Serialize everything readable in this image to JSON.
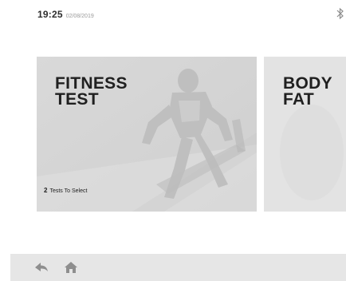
{
  "status": {
    "time": "19:25",
    "date": "02/08/2019",
    "icon": "bluetooth-icon"
  },
  "cards": [
    {
      "title": "FITNESS\nTEST",
      "subtitle_count": "2",
      "subtitle_text": "Tests To Select"
    },
    {
      "title": "BODY\nFAT"
    }
  ],
  "nav": {
    "back_icon": "back-arrow-icon",
    "home_icon": "home-icon"
  },
  "colors": {
    "card_bg": "#d5d5d5",
    "bottom_bar": "#e6e6e6",
    "text_dark": "#202020",
    "icon_grey": "#9a9a9a"
  }
}
